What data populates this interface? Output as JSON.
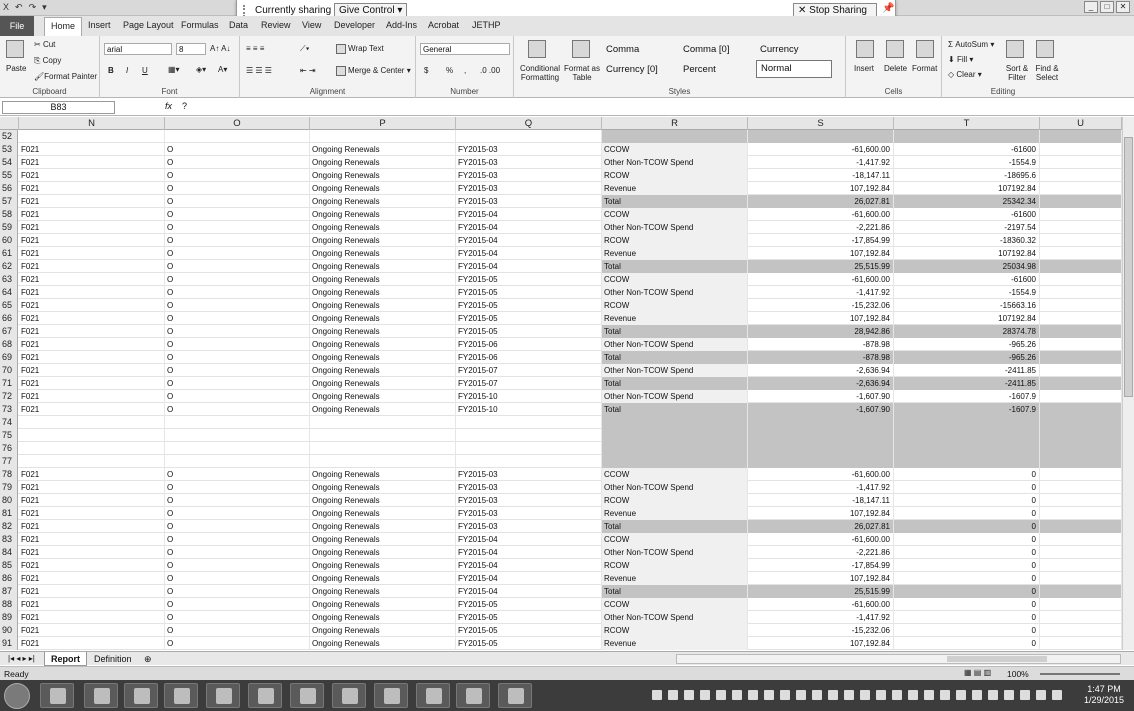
{
  "titlebar": {
    "qat_items": [
      "X",
      "↶",
      "↷",
      "▾"
    ],
    "window_controls": [
      "_",
      "□",
      "✕"
    ]
  },
  "sharing": {
    "status": "Currently sharing",
    "give_control": "Give Control",
    "stop": "Stop Sharing"
  },
  "tabs": [
    "File",
    "Home",
    "Insert",
    "Page Layout",
    "Formulas",
    "Data",
    "Review",
    "View",
    "Developer",
    "Add-Ins",
    "Acrobat",
    "JETHP"
  ],
  "ribbon": {
    "clipboard": {
      "paste": "Paste",
      "cut": "Cut",
      "copy": "Copy",
      "format_painter": "Format Painter",
      "label": "Clipboard"
    },
    "font": {
      "name": "arial",
      "size": "8",
      "label": "Font",
      "bold": "B",
      "italic": "I",
      "underline": "U"
    },
    "alignment": {
      "wrap": "Wrap Text",
      "merge": "Merge & Center",
      "label": "Alignment"
    },
    "number": {
      "format": "General",
      "currency": "$",
      "percent": "%",
      "comma": ",",
      "label": "Number"
    },
    "styles": {
      "conditional": "Conditional Formatting",
      "format_table": "Format as Table",
      "cells": [
        "Comma",
        "Comma [0]",
        "Currency",
        "Currency [0]",
        "Percent",
        "Normal"
      ],
      "label": "Styles"
    },
    "cells": {
      "insert": "Insert",
      "delete": "Delete",
      "format": "Format",
      "label": "Cells"
    },
    "editing": {
      "autosum": "AutoSum",
      "fill": "Fill",
      "clear": "Clear",
      "sort": "Sort & Filter",
      "find": "Find & Select",
      "label": "Editing"
    }
  },
  "formula_bar": {
    "name_box": "B83",
    "fx": "fx",
    "content": "?"
  },
  "columns": [
    "N",
    "O",
    "P",
    "Q",
    "R",
    "S",
    "T",
    "U"
  ],
  "rows": [
    {
      "n": "52",
      "kind": "blank-top"
    },
    {
      "n": "53",
      "a": "F021",
      "b": "O",
      "c": "Ongoing Renewals",
      "d": "FY2015-03",
      "e": "CCOW",
      "s": "-61,600.00",
      "t": "-61600"
    },
    {
      "n": "54",
      "a": "F021",
      "b": "O",
      "c": "Ongoing Renewals",
      "d": "FY2015-03",
      "e": "Other Non-TCOW Spend",
      "s": "-1,417.92",
      "t": "-1554.9"
    },
    {
      "n": "55",
      "a": "F021",
      "b": "O",
      "c": "Ongoing Renewals",
      "d": "FY2015-03",
      "e": "RCOW",
      "s": "-18,147.11",
      "t": "-18695.6"
    },
    {
      "n": "56",
      "a": "F021",
      "b": "O",
      "c": "Ongoing Renewals",
      "d": "FY2015-03",
      "e": "Revenue",
      "s": "107,192.84",
      "t": "107192.84"
    },
    {
      "n": "57",
      "a": "F021",
      "b": "O",
      "c": "Ongoing Renewals",
      "d": "FY2015-03",
      "e": "Total",
      "s": "26,027.81",
      "t": "25342.34",
      "kind": "total"
    },
    {
      "n": "58",
      "a": "F021",
      "b": "O",
      "c": "Ongoing Renewals",
      "d": "FY2015-04",
      "e": "CCOW",
      "s": "-61,600.00",
      "t": "-61600"
    },
    {
      "n": "59",
      "a": "F021",
      "b": "O",
      "c": "Ongoing Renewals",
      "d": "FY2015-04",
      "e": "Other Non-TCOW Spend",
      "s": "-2,221.86",
      "t": "-2197.54"
    },
    {
      "n": "60",
      "a": "F021",
      "b": "O",
      "c": "Ongoing Renewals",
      "d": "FY2015-04",
      "e": "RCOW",
      "s": "-17,854.99",
      "t": "-18360.32"
    },
    {
      "n": "61",
      "a": "F021",
      "b": "O",
      "c": "Ongoing Renewals",
      "d": "FY2015-04",
      "e": "Revenue",
      "s": "107,192.84",
      "t": "107192.84"
    },
    {
      "n": "62",
      "a": "F021",
      "b": "O",
      "c": "Ongoing Renewals",
      "d": "FY2015-04",
      "e": "Total",
      "s": "25,515.99",
      "t": "25034.98",
      "kind": "total"
    },
    {
      "n": "63",
      "a": "F021",
      "b": "O",
      "c": "Ongoing Renewals",
      "d": "FY2015-05",
      "e": "CCOW",
      "s": "-61,600.00",
      "t": "-61600"
    },
    {
      "n": "64",
      "a": "F021",
      "b": "O",
      "c": "Ongoing Renewals",
      "d": "FY2015-05",
      "e": "Other Non-TCOW Spend",
      "s": "-1,417.92",
      "t": "-1554.9"
    },
    {
      "n": "65",
      "a": "F021",
      "b": "O",
      "c": "Ongoing Renewals",
      "d": "FY2015-05",
      "e": "RCOW",
      "s": "-15,232.06",
      "t": "-15663.16"
    },
    {
      "n": "66",
      "a": "F021",
      "b": "O",
      "c": "Ongoing Renewals",
      "d": "FY2015-05",
      "e": "Revenue",
      "s": "107,192.84",
      "t": "107192.84"
    },
    {
      "n": "67",
      "a": "F021",
      "b": "O",
      "c": "Ongoing Renewals",
      "d": "FY2015-05",
      "e": "Total",
      "s": "28,942.86",
      "t": "28374.78",
      "kind": "total"
    },
    {
      "n": "68",
      "a": "F021",
      "b": "O",
      "c": "Ongoing Renewals",
      "d": "FY2015-06",
      "e": "Other Non-TCOW Spend",
      "s": "-878.98",
      "t": "-965.26"
    },
    {
      "n": "69",
      "a": "F021",
      "b": "O",
      "c": "Ongoing Renewals",
      "d": "FY2015-06",
      "e": "Total",
      "s": "-878.98",
      "t": "-965.26",
      "kind": "total"
    },
    {
      "n": "70",
      "a": "F021",
      "b": "O",
      "c": "Ongoing Renewals",
      "d": "FY2015-07",
      "e": "Other Non-TCOW Spend",
      "s": "-2,636.94",
      "t": "-2411.85"
    },
    {
      "n": "71",
      "a": "F021",
      "b": "O",
      "c": "Ongoing Renewals",
      "d": "FY2015-07",
      "e": "Total",
      "s": "-2,636.94",
      "t": "-2411.85",
      "kind": "total"
    },
    {
      "n": "72",
      "a": "F021",
      "b": "O",
      "c": "Ongoing Renewals",
      "d": "FY2015-10",
      "e": "Other Non-TCOW Spend",
      "s": "-1,607.90",
      "t": "-1607.9"
    },
    {
      "n": "73",
      "a": "F021",
      "b": "O",
      "c": "Ongoing Renewals",
      "d": "FY2015-10",
      "e": "Total",
      "s": "-1,607.90",
      "t": "-1607.9",
      "kind": "total"
    },
    {
      "n": "74",
      "kind": "blank"
    },
    {
      "n": "75",
      "kind": "blank"
    },
    {
      "n": "76",
      "kind": "blank"
    },
    {
      "n": "77",
      "kind": "blank"
    },
    {
      "n": "78",
      "a": "F021",
      "b": "O",
      "c": "Ongoing Renewals",
      "d": "FY2015-03",
      "e": "CCOW",
      "s": "-61,600.00",
      "t": "0"
    },
    {
      "n": "79",
      "a": "F021",
      "b": "O",
      "c": "Ongoing Renewals",
      "d": "FY2015-03",
      "e": "Other Non-TCOW Spend",
      "s": "-1,417.92",
      "t": "0"
    },
    {
      "n": "80",
      "a": "F021",
      "b": "O",
      "c": "Ongoing Renewals",
      "d": "FY2015-03",
      "e": "RCOW",
      "s": "-18,147.11",
      "t": "0"
    },
    {
      "n": "81",
      "a": "F021",
      "b": "O",
      "c": "Ongoing Renewals",
      "d": "FY2015-03",
      "e": "Revenue",
      "s": "107,192.84",
      "t": "0"
    },
    {
      "n": "82",
      "a": "F021",
      "b": "O",
      "c": "Ongoing Renewals",
      "d": "FY2015-03",
      "e": "Total",
      "s": "26,027.81",
      "t": "0",
      "kind": "total"
    },
    {
      "n": "83",
      "a": "F021",
      "b": "O",
      "c": "Ongoing Renewals",
      "d": "FY2015-04",
      "e": "CCOW",
      "s": "-61,600.00",
      "t": "0"
    },
    {
      "n": "84",
      "a": "F021",
      "b": "O",
      "c": "Ongoing Renewals",
      "d": "FY2015-04",
      "e": "Other Non-TCOW Spend",
      "s": "-2,221.86",
      "t": "0"
    },
    {
      "n": "85",
      "a": "F021",
      "b": "O",
      "c": "Ongoing Renewals",
      "d": "FY2015-04",
      "e": "RCOW",
      "s": "-17,854.99",
      "t": "0"
    },
    {
      "n": "86",
      "a": "F021",
      "b": "O",
      "c": "Ongoing Renewals",
      "d": "FY2015-04",
      "e": "Revenue",
      "s": "107,192.84",
      "t": "0"
    },
    {
      "n": "87",
      "a": "F021",
      "b": "O",
      "c": "Ongoing Renewals",
      "d": "FY2015-04",
      "e": "Total",
      "s": "25,515.99",
      "t": "0",
      "kind": "total"
    },
    {
      "n": "88",
      "a": "F021",
      "b": "O",
      "c": "Ongoing Renewals",
      "d": "FY2015-05",
      "e": "CCOW",
      "s": "-61,600.00",
      "t": "0"
    },
    {
      "n": "89",
      "a": "F021",
      "b": "O",
      "c": "Ongoing Renewals",
      "d": "FY2015-05",
      "e": "Other Non-TCOW Spend",
      "s": "-1,417.92",
      "t": "0"
    },
    {
      "n": "90",
      "a": "F021",
      "b": "O",
      "c": "Ongoing Renewals",
      "d": "FY2015-05",
      "e": "RCOW",
      "s": "-15,232.06",
      "t": "0"
    },
    {
      "n": "91",
      "a": "F021",
      "b": "O",
      "c": "Ongoing Renewals",
      "d": "FY2015-05",
      "e": "Revenue",
      "s": "107,192.84",
      "t": "0"
    }
  ],
  "sheets": [
    "Report",
    "Definition"
  ],
  "status": {
    "ready": "Ready",
    "zoom": "100%"
  },
  "clock": {
    "time": "1:47 PM",
    "date": "1/29/2015"
  }
}
